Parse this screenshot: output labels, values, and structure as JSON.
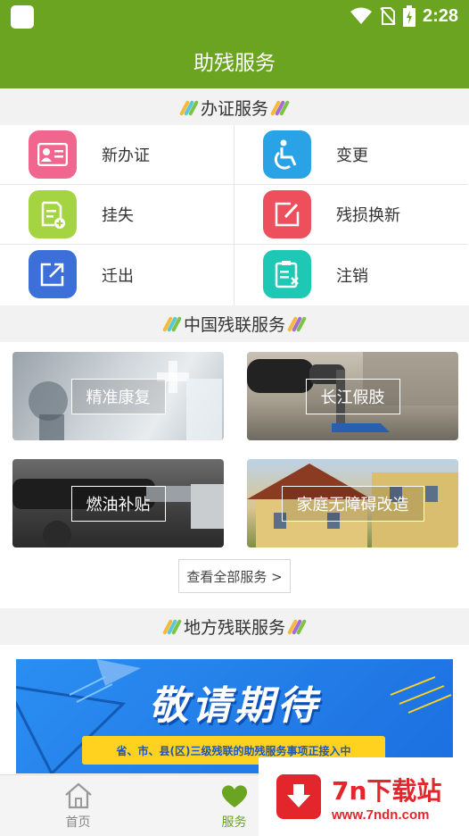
{
  "status_bar": {
    "time": "2:28"
  },
  "header": {
    "title": "助残服务"
  },
  "sections": {
    "certificate": "办证服务",
    "china": "中国残联服务",
    "local": "地方残联服务"
  },
  "certificate_services": [
    {
      "label": "新办证",
      "icon": "id-card-icon",
      "color": "#f0668e"
    },
    {
      "label": "变更",
      "icon": "wheelchair-icon",
      "color": "#2aa3e6"
    },
    {
      "label": "挂失",
      "icon": "document-add-icon",
      "color": "#a5d442"
    },
    {
      "label": "残损换新",
      "icon": "edit-icon",
      "color": "#ee4f5c"
    },
    {
      "label": "迁出",
      "icon": "export-icon",
      "color": "#3d6fd9"
    },
    {
      "label": "注销",
      "icon": "clipboard-cancel-icon",
      "color": "#1ec8b5"
    }
  ],
  "china_services": [
    {
      "label": "精准康复"
    },
    {
      "label": "长江假肢"
    },
    {
      "label": "燃油补贴"
    },
    {
      "label": "家庭无障碍改造"
    }
  ],
  "view_all_label": "查看全部服务 >",
  "banner": {
    "title": "敬请期待",
    "subtitle": "省、市、县(区)三级残联的助残服务事项正接入中"
  },
  "tabbar": {
    "items": [
      {
        "label": "首页",
        "icon": "home-icon"
      },
      {
        "label": "服务",
        "icon": "heart-icon"
      }
    ]
  },
  "watermark": {
    "title": "7n下载站",
    "url": "www.7ndn.com"
  },
  "colors": {
    "brand": "#6aa420"
  }
}
